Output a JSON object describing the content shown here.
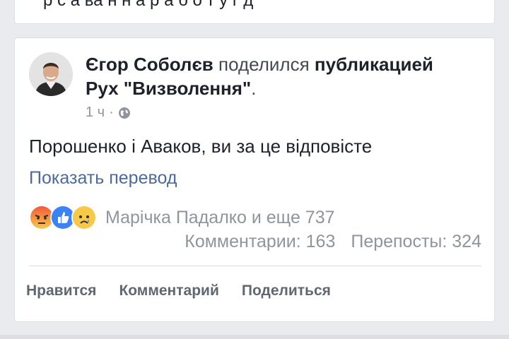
{
  "previous_post": {
    "cut_text": "р с а ва н н а р а б о т у г д"
  },
  "post": {
    "author": "Єгор Соболєв",
    "action": " поделился ",
    "action_object": "публикацией",
    "page": "Рух \"Визволення\"",
    "page_suffix": ".",
    "time": "1 ч",
    "meta_separator": "·",
    "privacy_icon": "globe-icon",
    "text": "Порошенко і Аваков, ви за це відповісте",
    "translate_link": "Показать перевод",
    "reactions": {
      "icons": [
        "angry-icon",
        "like-icon",
        "sad-icon"
      ],
      "summary": "Марічка Падалко и еще 737"
    },
    "comments": "Комментарии: 163",
    "shares": "Перепосты: 324",
    "actions": {
      "like": "Нравится",
      "comment": "Комментарий",
      "share": "Поделиться"
    }
  },
  "colors": {
    "link": "#4b6aa0",
    "meta": "#90949c",
    "like_blue": "#3b82f6",
    "angry_red": "#f05a3c",
    "sad_yellow": "#f7c948"
  }
}
